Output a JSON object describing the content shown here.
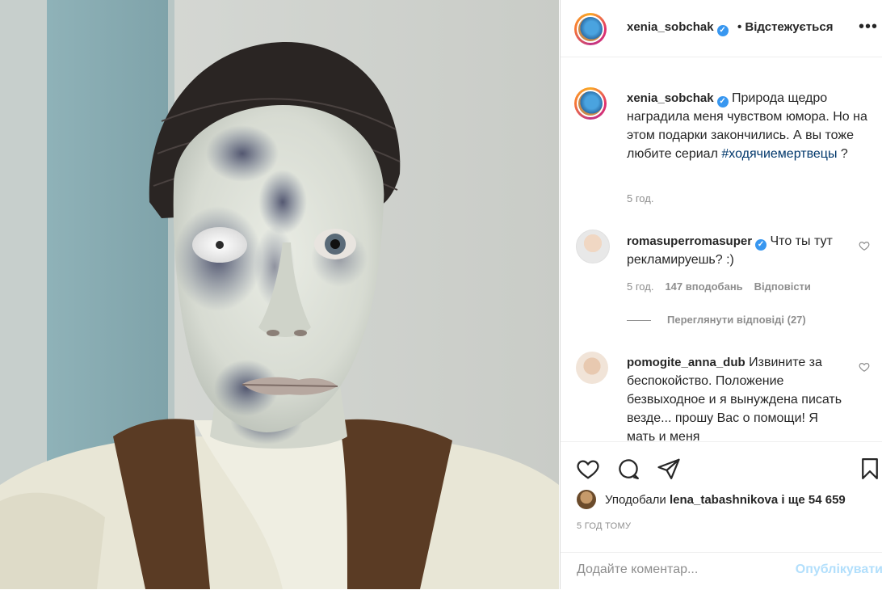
{
  "post": {
    "author": "xenia_sobchak",
    "follow_status": "Відстежується",
    "more_label": "•••",
    "caption_text": "Природа щедро наградила меня чувством юмора. Но на этом подарки закончились. А вы тоже любите сериал",
    "caption_hashtag": "#ходячиемертвецы",
    "caption_suffix": " ?",
    "caption_time": "5 год."
  },
  "comments": [
    {
      "author": "romasuperromasuper",
      "verified": true,
      "text": "Что ты тут рекламируешь? :)",
      "time": "5 год.",
      "likes": "147 вподобань",
      "reply_label": "Відповісти",
      "view_replies": "Переглянути відповіді (27)"
    },
    {
      "author": "pomogite_anna_dub",
      "verified": false,
      "text": "Извините за беспокойство. Положение безвыходное и я вынуждена писать везде... прошу Вас о помощи! Я мать и меня"
    }
  ],
  "likes_bar": {
    "prefix": "Уподобали",
    "liker": "lena_tabashnikova",
    "suffix": "і ще 54 659"
  },
  "post_time": "5 год тому",
  "comment_box": {
    "placeholder": "Додайте коментар...",
    "publish_label": "Опублікувати"
  },
  "icons": {
    "verified": "verified-badge-icon",
    "like": "heart-icon",
    "comment": "comment-bubble-icon",
    "share": "paper-plane-icon",
    "save": "bookmark-icon"
  },
  "colors": {
    "link_blue": "#00376b",
    "verified_blue": "#3897f0",
    "publish_disabled": "#b2dffc",
    "secondary_text": "#8e8e8e"
  }
}
